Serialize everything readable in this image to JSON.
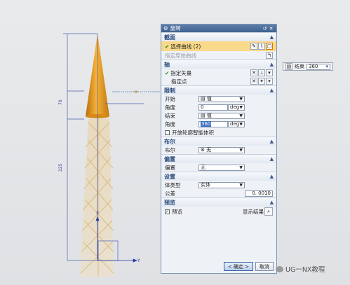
{
  "dialog": {
    "title": "旋转",
    "sections": {
      "section": {
        "header": "截面",
        "select_curve": "选择曲线 (2)",
        "origin_curve": "指定原始曲线"
      },
      "axis": {
        "header": "轴",
        "specify_vector": "指定矢量",
        "specify_point": "指定点"
      },
      "limits": {
        "header": "限制",
        "start_label": "开始",
        "start_value": "值",
        "angle1_label": "角度",
        "angle1_value": "0",
        "angle1_unit": "deg",
        "end_label": "结束",
        "end_value": "值",
        "angle2_label": "角度",
        "angle2_value": "360",
        "angle2_unit": "deg",
        "open_profile": "开放轮廓智能体积"
      },
      "boolean": {
        "header": "布尔",
        "label": "布尔",
        "value": "无"
      },
      "offset": {
        "header": "偏置",
        "label": "偏置",
        "value": "无"
      },
      "settings": {
        "header": "设置",
        "body_type_label": "体类型",
        "body_type_value": "实体",
        "tolerance_label": "公差",
        "tolerance_value": "0. 0010"
      },
      "preview": {
        "header": "预览",
        "preview_label": "预览",
        "show_result": "显示结果"
      }
    },
    "buttons": {
      "ok": "< 确定 >",
      "cancel": "取消"
    }
  },
  "float_toolbar": {
    "label": "结束",
    "value": "360"
  },
  "viewport": {
    "dim_small": "70",
    "dim_large": "225",
    "axis_y": "Y",
    "axis_x": "X"
  },
  "watermark": "UG一NX教程",
  "colors": {
    "accent": "#3f6291",
    "selection": "#f9d98a",
    "cone": "#f0a020"
  }
}
